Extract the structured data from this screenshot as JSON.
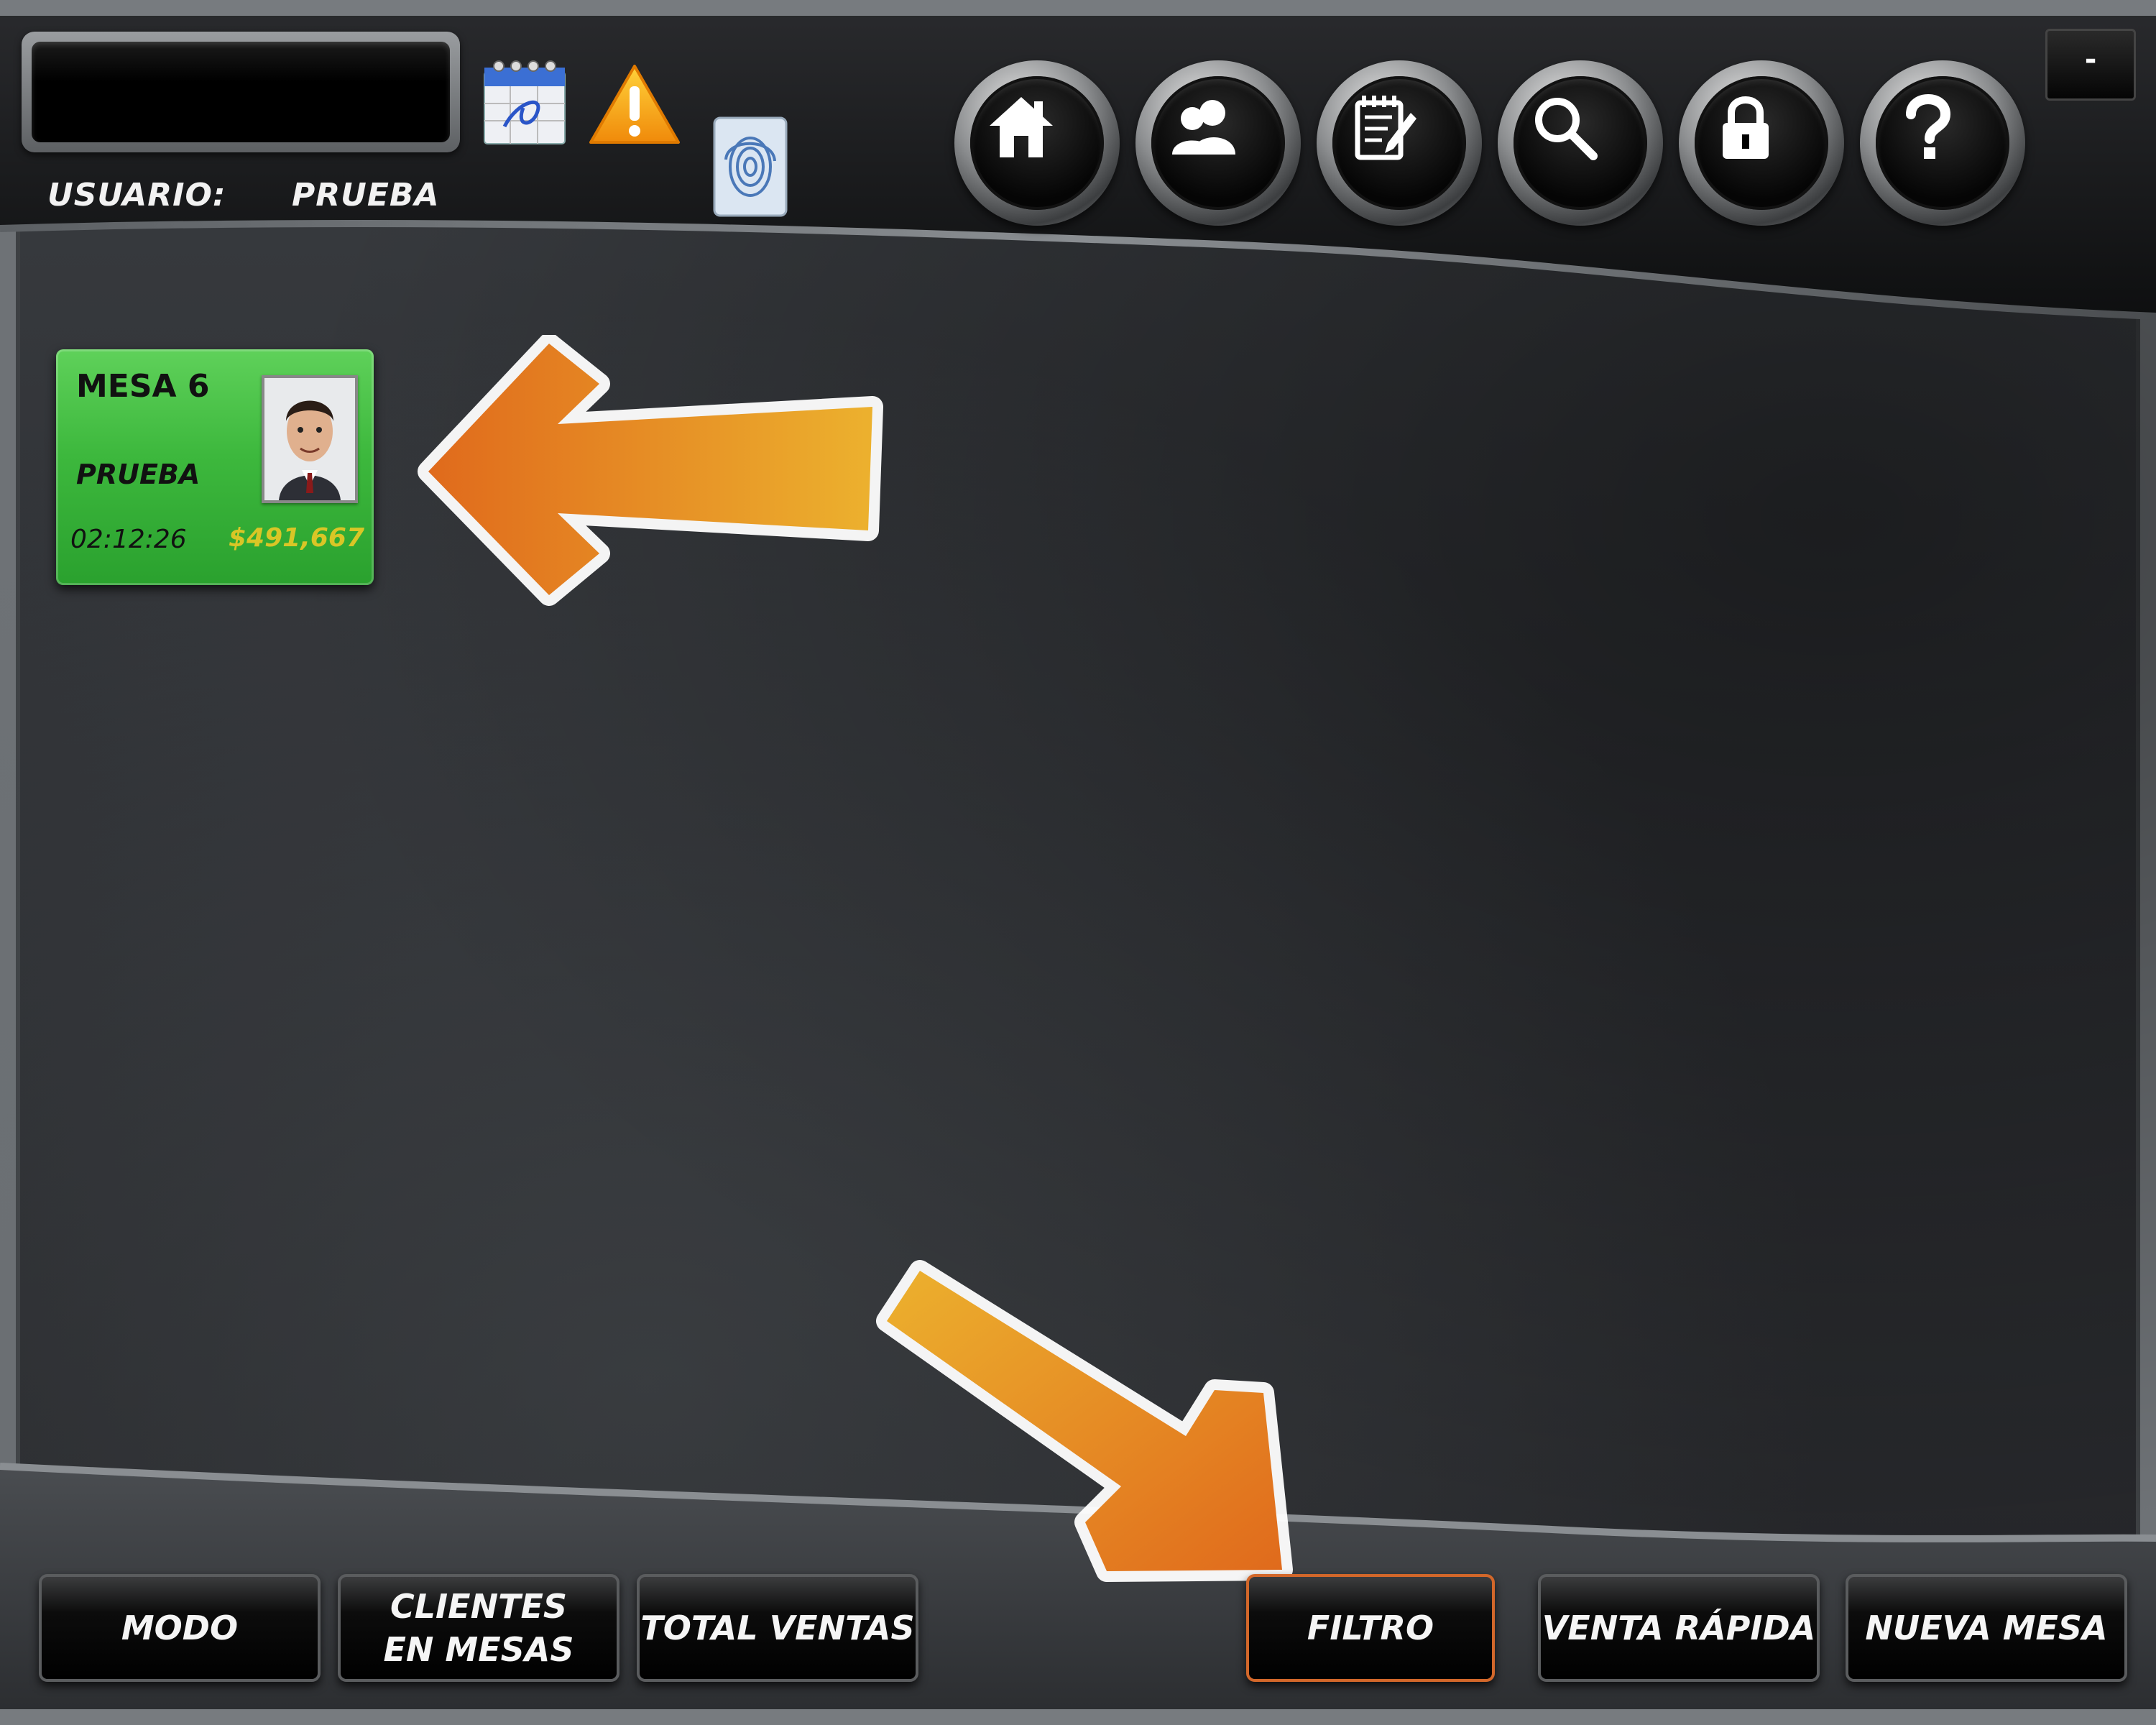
{
  "header": {
    "user_label": "USUARIO:",
    "user_value": "PRUEBA",
    "display_value": "",
    "icons": [
      "calendar-icon",
      "warning-icon",
      "fingerprint-icon"
    ],
    "nav_buttons": [
      "home-icon",
      "users-icon",
      "notes-icon",
      "search-icon",
      "lock-icon",
      "help-icon"
    ],
    "minimize_label": "-"
  },
  "mesas": [
    {
      "title": "MESA 6",
      "user": "PRUEBA",
      "time": "02:12:26",
      "amount": "$491,667",
      "status_color": "#3db83d"
    }
  ],
  "footer": {
    "modo": "MODO",
    "clientes": "CLIENTES EN MESAS",
    "total_ventas": "TOTAL VENTAS",
    "filtro": "FILTRO",
    "venta_rapida": "VENTA RÁPIDA",
    "nueva_mesa": "NUEVA MESA"
  },
  "colors": {
    "accent_orange": "#e8761c",
    "card_green": "#3db83d",
    "amount_yellow": "#d9c626",
    "active_border": "#d2672a"
  }
}
